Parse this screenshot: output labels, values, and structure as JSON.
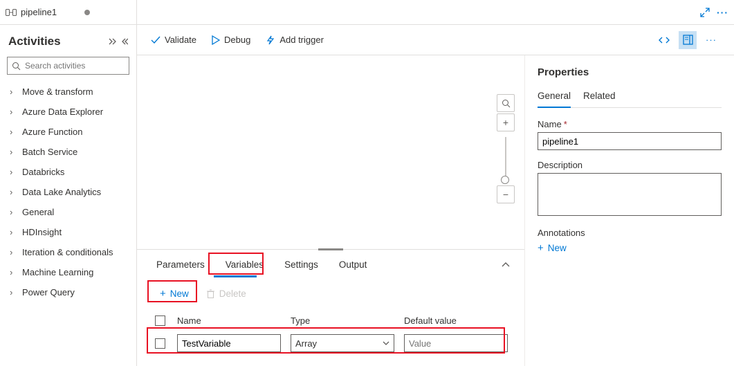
{
  "tab": {
    "title": "pipeline1"
  },
  "activities": {
    "title": "Activities",
    "search_placeholder": "Search activities",
    "items": [
      "Move & transform",
      "Azure Data Explorer",
      "Azure Function",
      "Batch Service",
      "Databricks",
      "Data Lake Analytics",
      "General",
      "HDInsight",
      "Iteration & conditionals",
      "Machine Learning",
      "Power Query"
    ]
  },
  "toolbar": {
    "validate": "Validate",
    "debug": "Debug",
    "add_trigger": "Add trigger"
  },
  "bottom_panel": {
    "tabs": {
      "parameters": "Parameters",
      "variables": "Variables",
      "settings": "Settings",
      "output": "Output"
    },
    "active_tab": "Variables",
    "new_label": "New",
    "delete_label": "Delete",
    "headers": {
      "name": "Name",
      "type": "Type",
      "default": "Default value"
    },
    "rows": [
      {
        "name": "TestVariable",
        "type": "Array",
        "default_placeholder": "Value"
      }
    ]
  },
  "properties": {
    "title": "Properties",
    "tabs": {
      "general": "General",
      "related": "Related"
    },
    "name_label": "Name",
    "name_value": "pipeline1",
    "description_label": "Description",
    "description_value": "",
    "annotations_label": "Annotations",
    "new_label": "New"
  }
}
